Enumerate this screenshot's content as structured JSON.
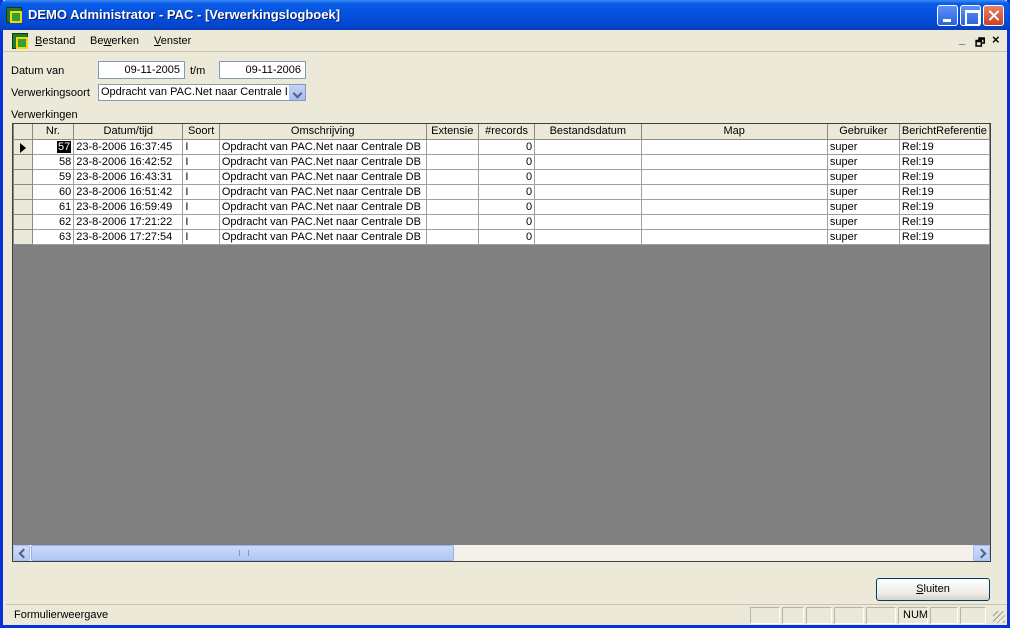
{
  "window": {
    "title": "DEMO Administrator  - PAC - [Verwerkingslogboek]"
  },
  "menu": {
    "items": [
      {
        "key": "B",
        "rest": "estand"
      },
      {
        "pre": "Be",
        "key": "w",
        "rest": "erken"
      },
      {
        "key": "V",
        "rest": "enster"
      }
    ],
    "mdi_min": "_",
    "mdi_restore": "🗗",
    "mdi_close": "×"
  },
  "filters": {
    "datum_van_label": "Datum van",
    "datum_van_value": "09-11-2005",
    "tm_label": "t/m",
    "tm_value": "09-11-2006",
    "soort_label": "Verwerkingsoort",
    "soort_value": "Opdracht van PAC.Net naar Centrale DB"
  },
  "grid": {
    "caption": "Verwerkingen",
    "columns": [
      "Nr.",
      "Datum/tijd",
      "Soort",
      "Omschrijving",
      "Extensie",
      "#records",
      "Bestandsdatum",
      "Map",
      "Gebruiker",
      "BerichtReferentie"
    ],
    "rows": [
      {
        "nr": "57",
        "datum": "23-8-2006 16:37:45",
        "soort": "I",
        "omschrijving": "Opdracht van PAC.Net naar Centrale DB",
        "extensie": "",
        "records": "0",
        "bestandsdatum": "",
        "map": "",
        "gebruiker": "super",
        "ref": "Rel:19"
      },
      {
        "nr": "58",
        "datum": "23-8-2006 16:42:52",
        "soort": "I",
        "omschrijving": "Opdracht van PAC.Net naar Centrale DB",
        "extensie": "",
        "records": "0",
        "bestandsdatum": "",
        "map": "",
        "gebruiker": "super",
        "ref": "Rel:19"
      },
      {
        "nr": "59",
        "datum": "23-8-2006 16:43:31",
        "soort": "I",
        "omschrijving": "Opdracht van PAC.Net naar Centrale DB",
        "extensie": "",
        "records": "0",
        "bestandsdatum": "",
        "map": "",
        "gebruiker": "super",
        "ref": "Rel:19"
      },
      {
        "nr": "60",
        "datum": "23-8-2006 16:51:42",
        "soort": "I",
        "omschrijving": "Opdracht van PAC.Net naar Centrale DB",
        "extensie": "",
        "records": "0",
        "bestandsdatum": "",
        "map": "",
        "gebruiker": "super",
        "ref": "Rel:19"
      },
      {
        "nr": "61",
        "datum": "23-8-2006 16:59:49",
        "soort": "I",
        "omschrijving": "Opdracht van PAC.Net naar Centrale DB",
        "extensie": "",
        "records": "0",
        "bestandsdatum": "",
        "map": "",
        "gebruiker": "super",
        "ref": "Rel:19"
      },
      {
        "nr": "62",
        "datum": "23-8-2006 17:21:22",
        "soort": "I",
        "omschrijving": "Opdracht van PAC.Net naar Centrale DB",
        "extensie": "",
        "records": "0",
        "bestandsdatum": "",
        "map": "",
        "gebruiker": "super",
        "ref": "Rel:19"
      },
      {
        "nr": "63",
        "datum": "23-8-2006 17:27:54",
        "soort": "I",
        "omschrijving": "Opdracht van PAC.Net naar Centrale DB",
        "extensie": "",
        "records": "0",
        "bestandsdatum": "",
        "map": "",
        "gebruiker": "super",
        "ref": "Rel:19"
      }
    ]
  },
  "buttons": {
    "close_key": "S",
    "close_rest": "luiten"
  },
  "status": {
    "text": "Formulierweergave",
    "num": "NUM"
  },
  "icons": [
    "app-icon",
    "minimize-icon",
    "maximize-icon",
    "close-icon",
    "combo-arrow-icon",
    "row-pointer-icon",
    "scroll-left-icon",
    "scroll-right-icon",
    "resize-grip-icon"
  ]
}
